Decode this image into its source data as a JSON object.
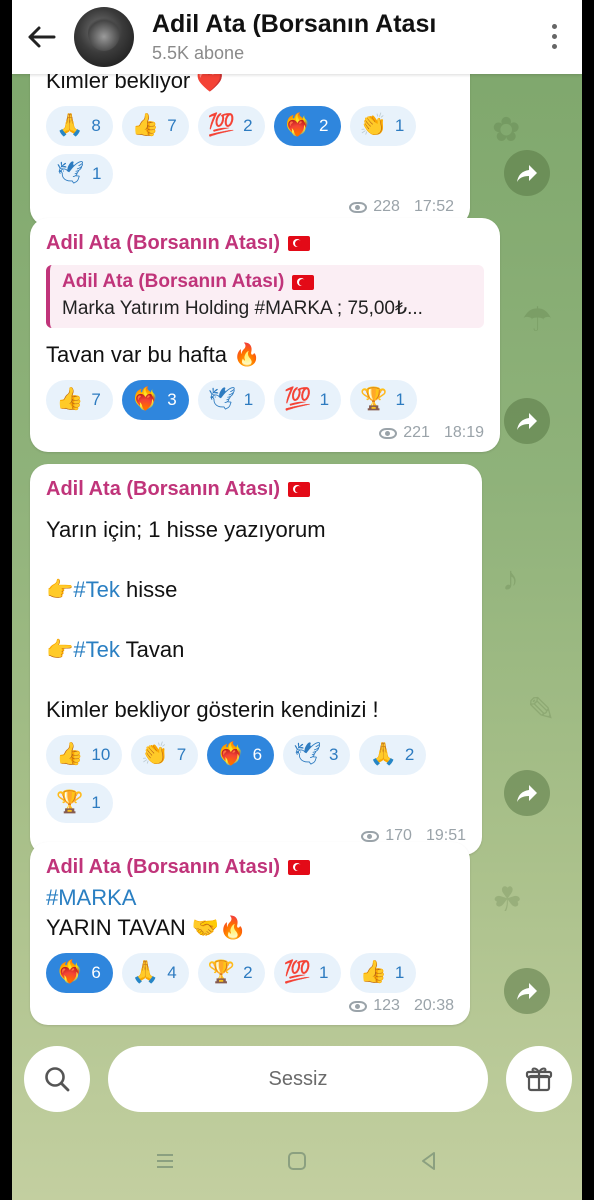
{
  "header": {
    "title": "Adil Ata (Borsanın Atası",
    "subtitle": "5.5K abone"
  },
  "messages": [
    {
      "text_top": "Kimler bekliyor ❤️",
      "reactions": [
        {
          "emoji": "🙏",
          "count": "8"
        },
        {
          "emoji": "👍",
          "count": "7"
        },
        {
          "emoji": "💯",
          "count": "2"
        },
        {
          "emoji": "❤️‍🔥",
          "count": "2",
          "active": true
        },
        {
          "emoji": "👏",
          "count": "1"
        },
        {
          "emoji": "🕊",
          "count": "1"
        }
      ],
      "views": "228",
      "time": "17:52"
    },
    {
      "sender": "Adil Ata (Borsanın Atası)",
      "reply_sender": "Adil Ata (Borsanın Atası)",
      "reply_text": "Marka Yatırım Holding #MARKA ; 75,00₺...",
      "text": "Tavan var bu hafta 🔥",
      "reactions": [
        {
          "emoji": "👍",
          "count": "7"
        },
        {
          "emoji": "❤️‍🔥",
          "count": "3",
          "active": true
        },
        {
          "emoji": "🕊",
          "count": "1"
        },
        {
          "emoji": "💯",
          "count": "1"
        },
        {
          "emoji": "🏆",
          "count": "1"
        }
      ],
      "views": "221",
      "time": "18:19"
    },
    {
      "sender": "Adil Ata (Borsanın Atası)",
      "line1": "Yarın için; 1 hisse yazıyorum",
      "line2_prefix": "👉",
      "line2_tag": "#Tek",
      "line2_rest": " hisse",
      "line3_prefix": "👉",
      "line3_tag": "#Tek",
      "line3_rest": " Tavan",
      "line4": "Kimler bekliyor gösterin kendinizi !",
      "reactions": [
        {
          "emoji": "👍",
          "count": "10"
        },
        {
          "emoji": "👏",
          "count": "7"
        },
        {
          "emoji": "❤️‍🔥",
          "count": "6",
          "active": true
        },
        {
          "emoji": "🕊",
          "count": "3"
        },
        {
          "emoji": "🙏",
          "count": "2"
        },
        {
          "emoji": "🏆",
          "count": "1"
        }
      ],
      "views": "170",
      "time": "19:51"
    },
    {
      "sender": "Adil Ata (Borsanın Atası)",
      "hashtag": "#MARKA",
      "text": "YARIN TAVAN 🤝🔥",
      "reactions": [
        {
          "emoji": "❤️‍🔥",
          "count": "6",
          "active": true
        },
        {
          "emoji": "🙏",
          "count": "4"
        },
        {
          "emoji": "🏆",
          "count": "2"
        },
        {
          "emoji": "💯",
          "count": "1"
        },
        {
          "emoji": "👍",
          "count": "1"
        }
      ],
      "views": "123",
      "time": "20:38"
    }
  ],
  "bottom": {
    "mute_label": "Sessiz"
  },
  "colors": {
    "sender": "#c0347a",
    "hashtag": "#2a7fc2",
    "reaction_active": "#2f86dd",
    "reaction_bg": "#e8f2fb"
  }
}
